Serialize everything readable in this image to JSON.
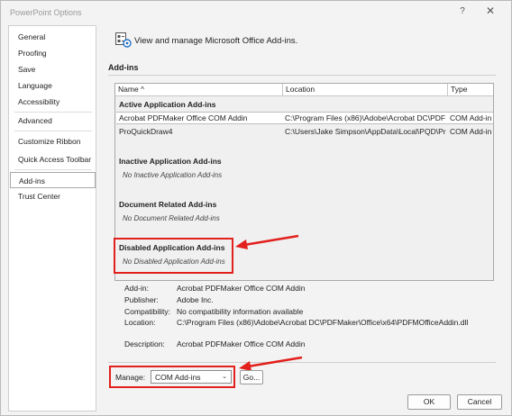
{
  "window": {
    "title": "PowerPoint Options",
    "help_glyph": "?",
    "close_glyph": "✕"
  },
  "sidebar": {
    "items": [
      {
        "label": "General"
      },
      {
        "label": "Proofing"
      },
      {
        "label": "Save"
      },
      {
        "label": "Language"
      },
      {
        "label": "Accessibility"
      },
      {
        "label": "Advanced"
      },
      {
        "label": "Customize Ribbon"
      },
      {
        "label": "Quick Access Toolbar"
      },
      {
        "label": "Add-ins"
      },
      {
        "label": "Trust Center"
      }
    ],
    "selected": "Add-ins"
  },
  "header": {
    "text": "View and manage Microsoft Office Add-ins.",
    "icon": "addins-manage-icon"
  },
  "section": {
    "title": "Add-ins"
  },
  "table": {
    "columns": [
      "Name ^",
      "Location",
      "Type"
    ],
    "groups": {
      "active": {
        "title": "Active Application Add-ins",
        "rows": [
          {
            "name": "Acrobat PDFMaker Office COM Addin",
            "location": "C:\\Program Files (x86)\\Adobe\\Acrobat DC\\PDF",
            "type": "COM Add-in"
          },
          {
            "name": "ProQuickDraw4",
            "location": "C:\\Users\\Jake Simpson\\AppData\\Local\\PQD\\Pr",
            "type": "COM Add-in"
          }
        ]
      },
      "inactive": {
        "title": "Inactive Application Add-ins",
        "empty": "No Inactive Application Add-ins"
      },
      "document": {
        "title": "Document Related Add-ins",
        "empty": "No Document Related Add-ins"
      },
      "disabled": {
        "title": "Disabled Application Add-ins",
        "empty": "No Disabled Application Add-ins"
      }
    }
  },
  "details": {
    "addin_label": "Add-in:",
    "addin_value": "Acrobat PDFMaker Office COM Addin",
    "publisher_label": "Publisher:",
    "publisher_value": "Adobe Inc.",
    "compat_label": "Compatibility:",
    "compat_value": "No compatibility information available",
    "location_label": "Location:",
    "location_value": "C:\\Program Files (x86)\\Adobe\\Acrobat DC\\PDFMaker\\Office\\x64\\PDFMOfficeAddin.dll",
    "description_label": "Description:",
    "description_value": "Acrobat PDFMaker Office COM Addin"
  },
  "manage": {
    "label": "Manage:",
    "selected": "COM Add-ins",
    "go_label": "Go..."
  },
  "buttons": {
    "ok": "OK",
    "cancel": "Cancel"
  },
  "colors": {
    "annotation_red": "#e2201c",
    "selection_border": "#a8a8a8",
    "accent_blue": "#1f6fc5"
  }
}
